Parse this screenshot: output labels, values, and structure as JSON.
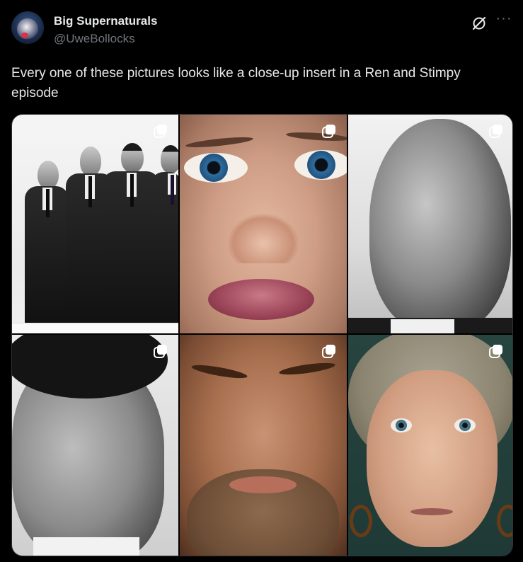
{
  "post": {
    "display_name": "Big Supernaturals",
    "handle": "@UweBollocks",
    "text": "Every one of these pictures looks like a close-up insert in a Ren and Stimpy episode"
  },
  "icons": {
    "grok": "grok-icon",
    "more": "more-icon",
    "image_badge": "copy-icon"
  },
  "media": {
    "images": [
      {
        "name": "group-of-men-in-suits"
      },
      {
        "name": "woman-close-up"
      },
      {
        "name": "bald-man-portrait"
      },
      {
        "name": "dark-haired-man-portrait"
      },
      {
        "name": "bearded-man-close-up"
      },
      {
        "name": "blonde-woman-portrait"
      }
    ]
  },
  "colors": {
    "background": "#000000",
    "text": "#e7e9ea",
    "secondary_text": "#71767b",
    "border": "#2f3336"
  }
}
